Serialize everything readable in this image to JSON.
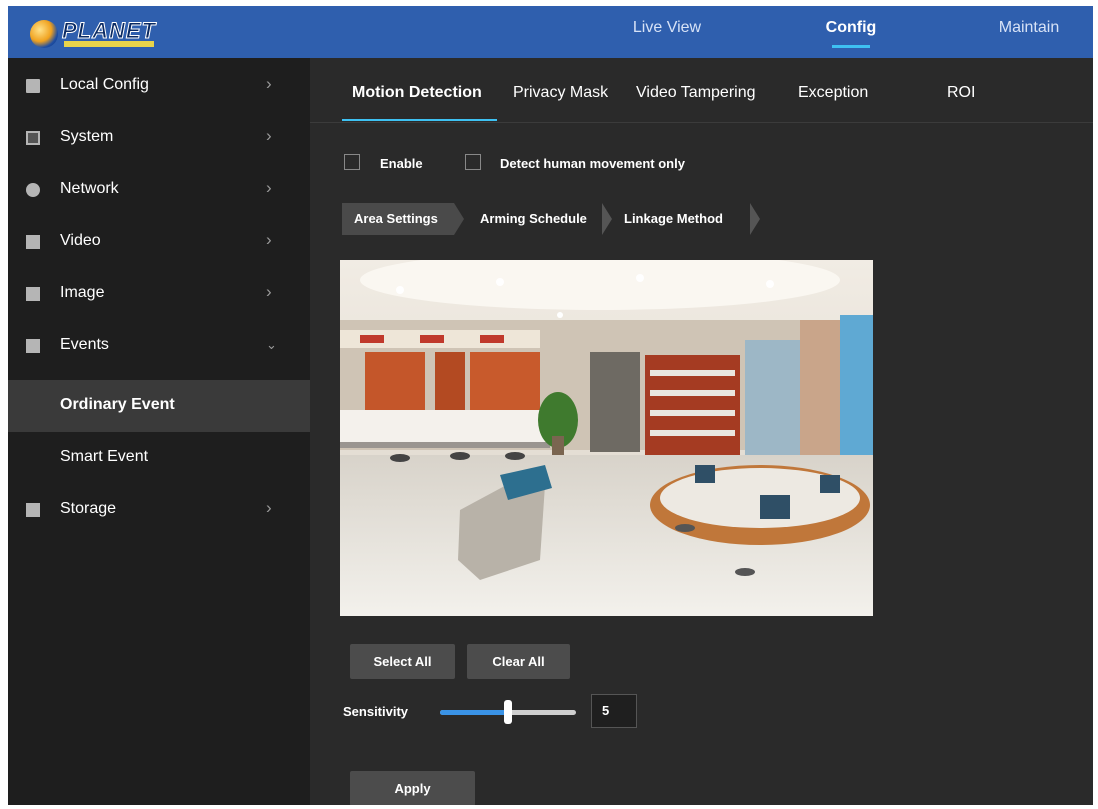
{
  "header": {
    "brand": "PLANET",
    "nav": [
      {
        "label": "Live View"
      },
      {
        "label": "Config"
      },
      {
        "label": "Maintain"
      }
    ],
    "active_nav": "Config",
    "accent_color": "#3ec1f2",
    "bar_color": "#2f5fae"
  },
  "sidebar": {
    "items": [
      {
        "label": "Local Config",
        "icon": "monitor-icon",
        "expanded": false
      },
      {
        "label": "System",
        "icon": "system-icon",
        "expanded": false
      },
      {
        "label": "Network",
        "icon": "network-icon",
        "expanded": false
      },
      {
        "label": "Video",
        "icon": "video-icon",
        "expanded": false
      },
      {
        "label": "Image",
        "icon": "image-icon",
        "expanded": false
      },
      {
        "label": "Events",
        "icon": "events-icon",
        "expanded": true
      },
      {
        "label": "Storage",
        "icon": "storage-icon",
        "expanded": false
      }
    ],
    "sub_items": [
      {
        "label": "Ordinary Event",
        "active": true
      },
      {
        "label": "Smart Event",
        "active": false
      }
    ]
  },
  "tabs": [
    {
      "label": "Motion Detection",
      "active": true
    },
    {
      "label": "Privacy Mask",
      "active": false
    },
    {
      "label": "Video Tampering",
      "active": false
    },
    {
      "label": "Exception",
      "active": false
    },
    {
      "label": "ROI",
      "active": false
    }
  ],
  "options": {
    "enable_label": "Enable",
    "enable_checked": false,
    "human_label": "Detect human movement only",
    "human_checked": false
  },
  "steps": [
    {
      "label": "Area Settings",
      "active": true
    },
    {
      "label": "Arming Schedule",
      "active": false
    },
    {
      "label": "Linkage Method",
      "active": false
    }
  ],
  "area_buttons": {
    "select_all": "Select All",
    "clear_all": "Clear All"
  },
  "sensitivity": {
    "label": "Sensitivity",
    "value": "5",
    "level_fraction": 0.5
  },
  "apply_label": "Apply"
}
